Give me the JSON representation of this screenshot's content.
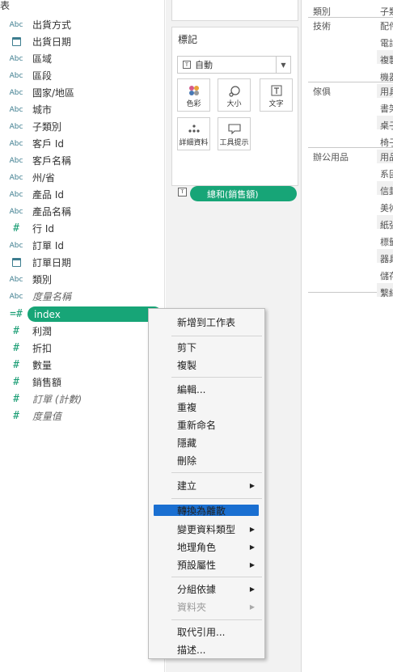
{
  "data_pane": {
    "title": "表",
    "fields": [
      {
        "icon": "Abc",
        "name": "出貨方式",
        "kind": "dim"
      },
      {
        "icon": "date",
        "name": "出貨日期",
        "kind": "dim"
      },
      {
        "icon": "Abc",
        "name": "區域",
        "kind": "dim"
      },
      {
        "icon": "Abc",
        "name": "區段",
        "kind": "dim"
      },
      {
        "icon": "Abc",
        "name": "國家/地區",
        "kind": "dim"
      },
      {
        "icon": "Abc",
        "name": "城市",
        "kind": "dim"
      },
      {
        "icon": "Abc",
        "name": "子類別",
        "kind": "dim"
      },
      {
        "icon": "Abc",
        "name": "客戶 Id",
        "kind": "dim"
      },
      {
        "icon": "Abc",
        "name": "客戶名稱",
        "kind": "dim"
      },
      {
        "icon": "Abc",
        "name": "州/省",
        "kind": "dim"
      },
      {
        "icon": "Abc",
        "name": "產品 Id",
        "kind": "dim"
      },
      {
        "icon": "Abc",
        "name": "產品名稱",
        "kind": "dim"
      },
      {
        "icon": "#",
        "name": "行 Id",
        "kind": "meas"
      },
      {
        "icon": "Abc",
        "name": "訂單 Id",
        "kind": "dim"
      },
      {
        "icon": "date",
        "name": "訂單日期",
        "kind": "dim"
      },
      {
        "icon": "Abc",
        "name": "類別",
        "kind": "dim"
      },
      {
        "icon": "Abc",
        "name": "度量名稱",
        "kind": "dim-italic"
      },
      {
        "icon": "=#",
        "name": "index",
        "kind": "selected"
      },
      {
        "icon": "#",
        "name": "利潤",
        "kind": "meas"
      },
      {
        "icon": "#",
        "name": "折扣",
        "kind": "meas"
      },
      {
        "icon": "#",
        "name": "數量",
        "kind": "meas"
      },
      {
        "icon": "#",
        "name": "銷售額",
        "kind": "meas"
      },
      {
        "icon": "#",
        "name": "訂單 (計數)",
        "kind": "meas-italic"
      },
      {
        "icon": "#",
        "name": "度量值",
        "kind": "meas-italic"
      }
    ]
  },
  "marks": {
    "title": "標記",
    "mark_type": "自動",
    "buttons": {
      "color": "色彩",
      "size": "大小",
      "text": "文字",
      "detail": "詳細資料",
      "tooltip": "工具提示"
    },
    "pill": "總和(銷售額)"
  },
  "table": {
    "headers": [
      "類別",
      "子類"
    ],
    "groups": [
      "技術",
      "傢俱",
      "辦公用品"
    ],
    "subcats": [
      "配件",
      "電話",
      "複製",
      "機器",
      "用具",
      "書架",
      "桌子",
      "椅子",
      "用品",
      "系固",
      "信封",
      "美術",
      "紙張",
      "標籤",
      "器具",
      "儲存",
      "繫結"
    ]
  },
  "context_menu": {
    "items": [
      {
        "label": "新增到工作表",
        "arrow": false
      },
      {
        "label": "剪下",
        "arrow": false
      },
      {
        "label": "複製",
        "arrow": false
      },
      {
        "label": "編輯...",
        "arrow": false
      },
      {
        "label": "重複",
        "arrow": false
      },
      {
        "label": "重新命名",
        "arrow": false
      },
      {
        "label": "隱藏",
        "arrow": false
      },
      {
        "label": "刪除",
        "arrow": false
      },
      {
        "label": "建立",
        "arrow": true
      },
      {
        "label": "轉換為離散",
        "arrow": false,
        "highlighted": true
      },
      {
        "label": "變更資料類型",
        "arrow": true
      },
      {
        "label": "地理角色",
        "arrow": true
      },
      {
        "label": "預設屬性",
        "arrow": true
      },
      {
        "label": "分組依據",
        "arrow": true
      },
      {
        "label": "資料夾",
        "arrow": true,
        "disabled": true
      },
      {
        "label": "取代引用...",
        "arrow": false
      },
      {
        "label": "描述...",
        "arrow": false
      }
    ]
  },
  "colors": {
    "pill_green": "#17a577",
    "highlight_blue": "#1a6fd1",
    "dimension_blue": "#3d7d8f",
    "measure_green": "#159b71"
  }
}
